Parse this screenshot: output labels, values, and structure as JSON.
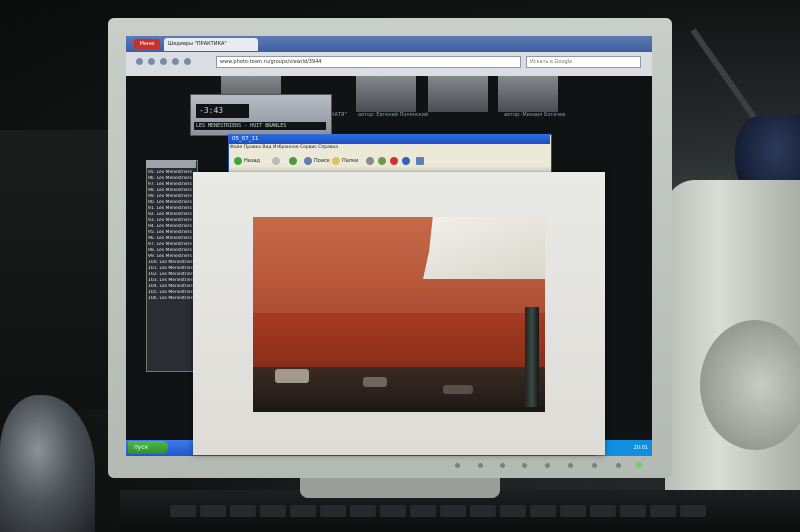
{
  "browser": {
    "menu_label": "Меню",
    "tab_title": "Шедевры \"ПРАКТИКА\"",
    "address": "www.photo-town.ru/groups/view/id/3944",
    "search_placeholder": "Искать в Google",
    "authors": [
      "автор: Евгений Полянский",
      "автор: Михаил Богачев"
    ],
    "caption_fragment": "КАТЯ\""
  },
  "winamp": {
    "time": "-3:43",
    "marquee": "LES MENESTRIERS - HUIT BRANLES"
  },
  "playlist": {
    "items": [
      "95. Les Menestriers",
      "96. Les Menestriers",
      "97. Les Menestriers",
      "98. Les Menestriers",
      "99. Les Menestriers",
      "90. Les Menestriers",
      "91. Les Menestriers",
      "92. Les Menestriers",
      "93. Les Menestriers",
      "94. Les Menestriers",
      "95. Les Menestriers",
      "96. Les Menestriers",
      "97. Les Menestriers",
      "98. Les Menestriers",
      "99. Les Menestriers",
      "100. Les Menestriers",
      "101. Les Menestriers",
      "102. Les Menestriers",
      "103. Les Menestriers",
      "104. Les Menestriers",
      "105. Les Menestriers",
      "106. Les Menestriers"
    ]
  },
  "explorer": {
    "title": "05_07_11",
    "menu": "Файл   Правка   Вид   Избранное   Сервис   Справка",
    "back_label": "Назад",
    "search_label": "Поиск",
    "folders_label": "Папки"
  },
  "taskbar": {
    "start_label": "пуск",
    "clock": "20:01"
  },
  "colors": {
    "brick": "#b8573a",
    "xp_blue": "#1f58cf",
    "paper": "#e6e5e1",
    "monitor_bezel": "#c3c8c2"
  }
}
